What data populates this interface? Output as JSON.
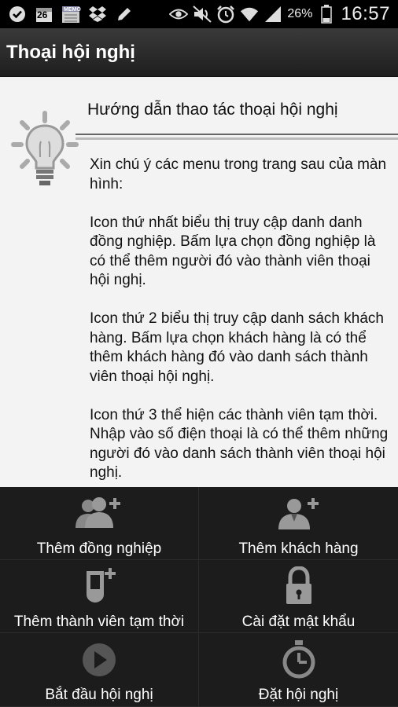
{
  "status_bar": {
    "icons_left": [
      "check-circle-icon",
      "calendar-icon",
      "memo-icon",
      "dropbox-icon",
      "pencil-icon"
    ],
    "calendar_day": "26",
    "memo_label": "MEMO",
    "icons_right": [
      "eye-icon",
      "mute-icon",
      "alarm-icon",
      "wifi-icon",
      "signal-icon",
      "battery-icon"
    ],
    "battery": "26%",
    "time": "16:57"
  },
  "titlebar": {
    "title": "Thoại hội nghị"
  },
  "content": {
    "heading": "Hướng dẫn thao tác thoại hội nghị",
    "paragraphs": [
      "Xin chú ý các menu trong trang sau của màn hình:",
      " Icon thứ nhất biểu thị truy cập danh danh đồng nghiệp. Bấm lựa chọn đồng nghiệp là có thể thêm người đó vào thành viên thoại hội nghị.",
      " Icon thứ 2 biểu thị truy cập danh sách khách hàng. Bấm lựa chọn khách hàng là có thể thêm khách hàng đó vào danh sách thành viên thoại hội nghị.",
      " Icon thứ 3 thể hiện các thành viên tạm thời. Nhập vào số điện thoại là có thể thêm những người đó vào danh sách thành viên thoại hội nghị."
    ]
  },
  "menu": {
    "items": [
      {
        "label": "Thêm đồng nghiệp",
        "icon": "add-colleague-icon"
      },
      {
        "label": "Thêm khách hàng",
        "icon": "add-customer-icon"
      },
      {
        "label": "Thêm thành viên tạm thời",
        "icon": "add-temp-member-icon"
      },
      {
        "label": "Cài đặt mật khẩu",
        "icon": "lock-icon"
      },
      {
        "label": "Bắt đầu hội nghị",
        "icon": "play-icon"
      },
      {
        "label": "Đặt hội nghị",
        "icon": "timer-icon"
      }
    ]
  }
}
